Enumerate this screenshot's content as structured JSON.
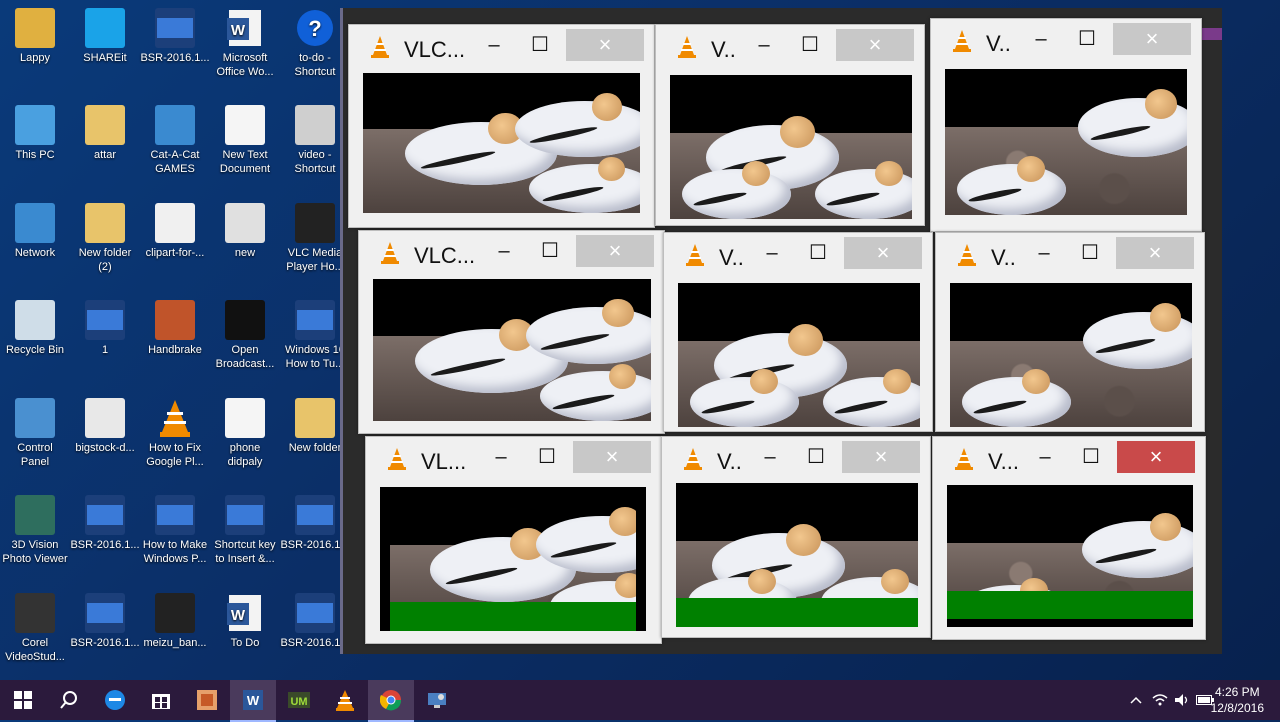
{
  "desktop": {
    "icons": [
      {
        "label": "Lappy"
      },
      {
        "label": "SHAREit"
      },
      {
        "label": "BSR-2016.1..."
      },
      {
        "label": "Microsoft\nOffice Wo..."
      },
      {
        "label": "to-do -\nShortcut"
      },
      {
        "label": "This PC"
      },
      {
        "label": "attar"
      },
      {
        "label": "Cat-A-Cat\nGAMES"
      },
      {
        "label": "New Text\nDocument"
      },
      {
        "label": "video -\nShortcut"
      },
      {
        "label": "Network"
      },
      {
        "label": "New folder\n(2)"
      },
      {
        "label": "clipart-for-..."
      },
      {
        "label": "new"
      },
      {
        "label": "VLC Media\nPlayer Ho..."
      },
      {
        "label": "Recycle Bin"
      },
      {
        "label": "1"
      },
      {
        "label": "Handbrake"
      },
      {
        "label": "Open\nBroadcast..."
      },
      {
        "label": "Windows 10\nHow to Tu..."
      },
      {
        "label": "Control\nPanel"
      },
      {
        "label": "bigstock-d..."
      },
      {
        "label": "How to Fix\nGoogle Pl..."
      },
      {
        "label": "phone\ndidpaly"
      },
      {
        "label": "New folder"
      },
      {
        "label": "3D Vision\nPhoto Viewer"
      },
      {
        "label": "BSR-2016.1..."
      },
      {
        "label": "How to Make\nWindows P..."
      },
      {
        "label": "Shortcut key\nto Insert &..."
      },
      {
        "label": "BSR-2016.1..."
      },
      {
        "label": "Corel\nVideoStud..."
      },
      {
        "label": "BSR-2016.1..."
      },
      {
        "label": "meizu_ban..."
      },
      {
        "label": "To Do"
      },
      {
        "label": "BSR-2016.1..."
      }
    ]
  },
  "windows": [
    {
      "title": "VLC...",
      "close_state": "normal",
      "green": false
    },
    {
      "title": "V..",
      "close_state": "normal",
      "green": false
    },
    {
      "title": "V..",
      "close_state": "normal",
      "green": false
    },
    {
      "title": "VLC...",
      "close_state": "normal",
      "green": false
    },
    {
      "title": "V..",
      "close_state": "normal",
      "green": false
    },
    {
      "title": "V..",
      "close_state": "normal",
      "green": false
    },
    {
      "title": "VL...",
      "close_state": "normal",
      "green": true
    },
    {
      "title": "V..",
      "close_state": "normal",
      "green": true
    },
    {
      "title": "V...",
      "close_state": "hover",
      "green": true
    }
  ],
  "window_buttons": {
    "minimize": "–",
    "maximize": "☐",
    "close": "×"
  },
  "taskbar": {
    "apps": [
      "start",
      "search",
      "edge",
      "store",
      "powerpoint",
      "word",
      "camtasia",
      "vlc",
      "chrome",
      "remote"
    ],
    "clock_time": "4:26 PM",
    "clock_date": "12/8/2016"
  },
  "colors": {
    "taskbar": "#2b1a3c",
    "vlc_orange": "#f08a00",
    "close_hover": "#c94a4a",
    "video_green": "#008000"
  }
}
